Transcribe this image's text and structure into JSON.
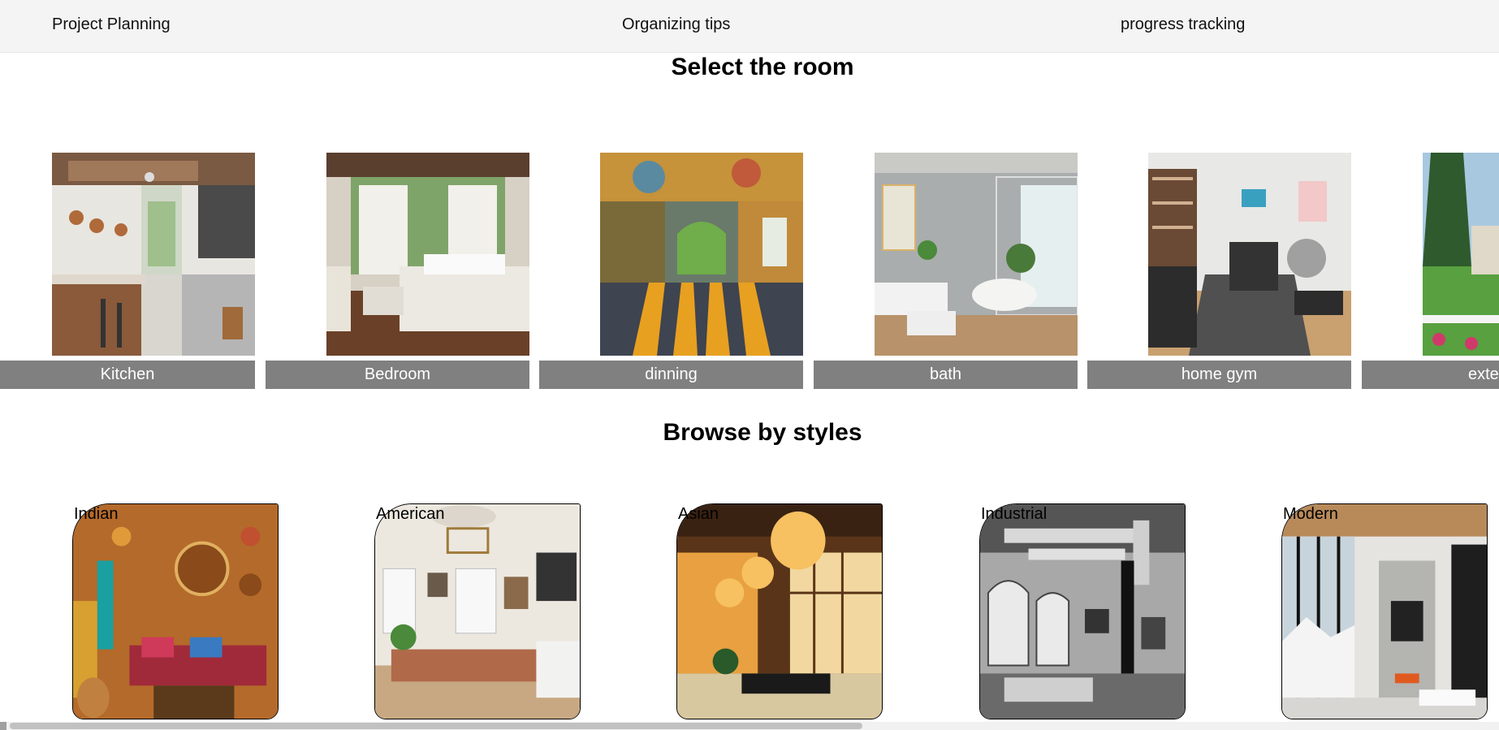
{
  "nav": {
    "items": [
      "Project Planning",
      "Organizing tips",
      "progress tracking"
    ]
  },
  "rooms": {
    "title": "Select the room",
    "items": [
      {
        "label": "Kitchen"
      },
      {
        "label": "Bedroom"
      },
      {
        "label": "dinning"
      },
      {
        "label": "bath"
      },
      {
        "label": "home gym"
      },
      {
        "label": "exter"
      }
    ]
  },
  "styles": {
    "title": "Browse by styles",
    "items": [
      {
        "label": "Indian"
      },
      {
        "label": "American"
      },
      {
        "label": "Asian"
      },
      {
        "label": "Industrial"
      },
      {
        "label": "Modern"
      }
    ]
  },
  "colors": {
    "nav_bg": "#f4f4f4",
    "room_label_bg": "#808080",
    "room_label_text": "#ffffff",
    "scroll_thumb": "#c1c1c1"
  }
}
